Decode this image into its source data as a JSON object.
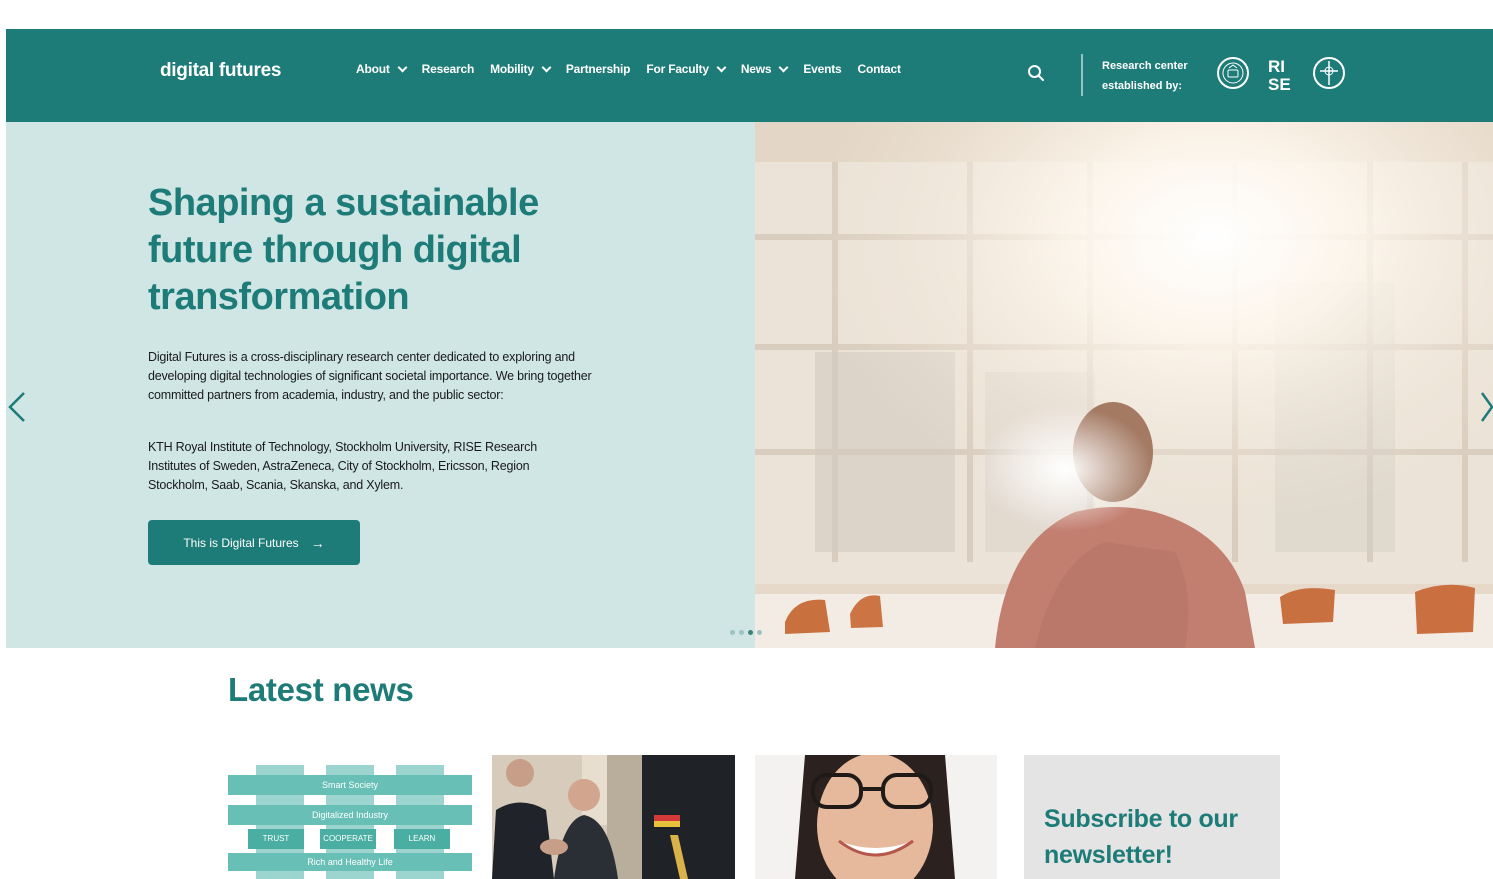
{
  "header": {
    "logo": "digital futures",
    "nav": [
      {
        "label": "About",
        "dropdown": true
      },
      {
        "label": "Research",
        "dropdown": false
      },
      {
        "label": "Mobility",
        "dropdown": true
      },
      {
        "label": "Partnership",
        "dropdown": false
      },
      {
        "label": "For Faculty",
        "dropdown": true
      },
      {
        "label": "News",
        "dropdown": true
      },
      {
        "label": "Events",
        "dropdown": false
      },
      {
        "label": "Contact",
        "dropdown": false
      }
    ],
    "established_line1": "Research center",
    "established_line2": "established by:",
    "partner_logos": [
      "kth-logo",
      "rise-logo",
      "stockholm-university-logo"
    ],
    "rise_text_1": "RI",
    "rise_text_2": "SE"
  },
  "hero": {
    "title": "Shaping a sustainable future through digital transformation",
    "paragraph1": "Digital Futures is a cross-disciplinary research center dedicated to exploring and developing digital technologies of significant societal importance. We bring together committed partners from academia, industry, and the public sector:",
    "paragraph2": "KTH Royal Institute of Technology, Stockholm University, RISE Research Institutes of Sweden, AstraZeneca, City of Stockholm, Ericsson, Region Stockholm, Saab, Scania, Skanska, and Xylem.",
    "cta_label": "This is Digital Futures",
    "cta_arrow": "→",
    "slides_count": 4,
    "active_slide": 3
  },
  "news": {
    "title": "Latest news",
    "card1_labels": [
      "Smart Society",
      "Digitalized Industry",
      "TRUST",
      "COOPERATE",
      "LEARN",
      "Rich and Healthy Life"
    ],
    "subscribe": "Subscribe to our newsletter!"
  },
  "colors": {
    "brand": "#1d7b78",
    "hero_bg": "#cfe6e5",
    "newsletter_bg": "#e4e4e4"
  }
}
